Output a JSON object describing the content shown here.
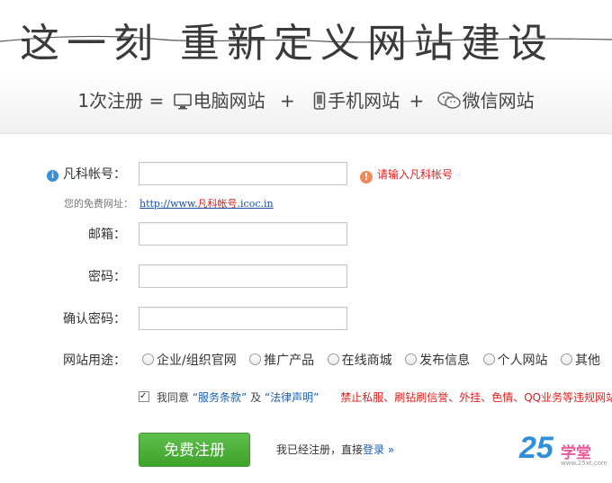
{
  "header": {
    "slogan": "这一刻 重新定义网站建设",
    "sub_prefix": "1次注册 =",
    "plus": "+",
    "products": [
      {
        "name": "电脑网站",
        "icon": "monitor-icon"
      },
      {
        "name": "手机网站",
        "icon": "phone-icon"
      },
      {
        "name": "微信网站",
        "icon": "wechat-icon"
      }
    ]
  },
  "form": {
    "account_label": "凡科帐号：",
    "account_value": "",
    "account_error": "请输入凡科帐号",
    "url_label": "您的免费网址：",
    "url_prefix": "http://www.",
    "url_highlight": "凡科帐号",
    "url_suffix": ".icoc.in",
    "email_label": "邮箱：",
    "password_label": "密码：",
    "confirm_label": "确认密码：",
    "purpose_label": "网站用途：",
    "purpose_options": [
      "企业/组织官网",
      "推广产品",
      "在线商城",
      "发布信息",
      "个人网站",
      "其他"
    ],
    "agree_text_1": "我同意",
    "agree_terms": "“服务条款”",
    "agree_and": "及",
    "agree_legal": "“法律声明”",
    "agree_warning": "禁止私服、刷钻刷信誉、外挂、色情、QQ业务等违规网站。",
    "submit_label": "免费注册",
    "login_prefix": "我已经注册，直接",
    "login_link": "登录 »"
  },
  "watermark": {
    "big": "25",
    "text": "学堂",
    "small": "www.25xt.com"
  },
  "colors": {
    "accent_green": "#4cb23a",
    "error_red": "#e0221f",
    "link_blue": "#1a5fb4"
  }
}
